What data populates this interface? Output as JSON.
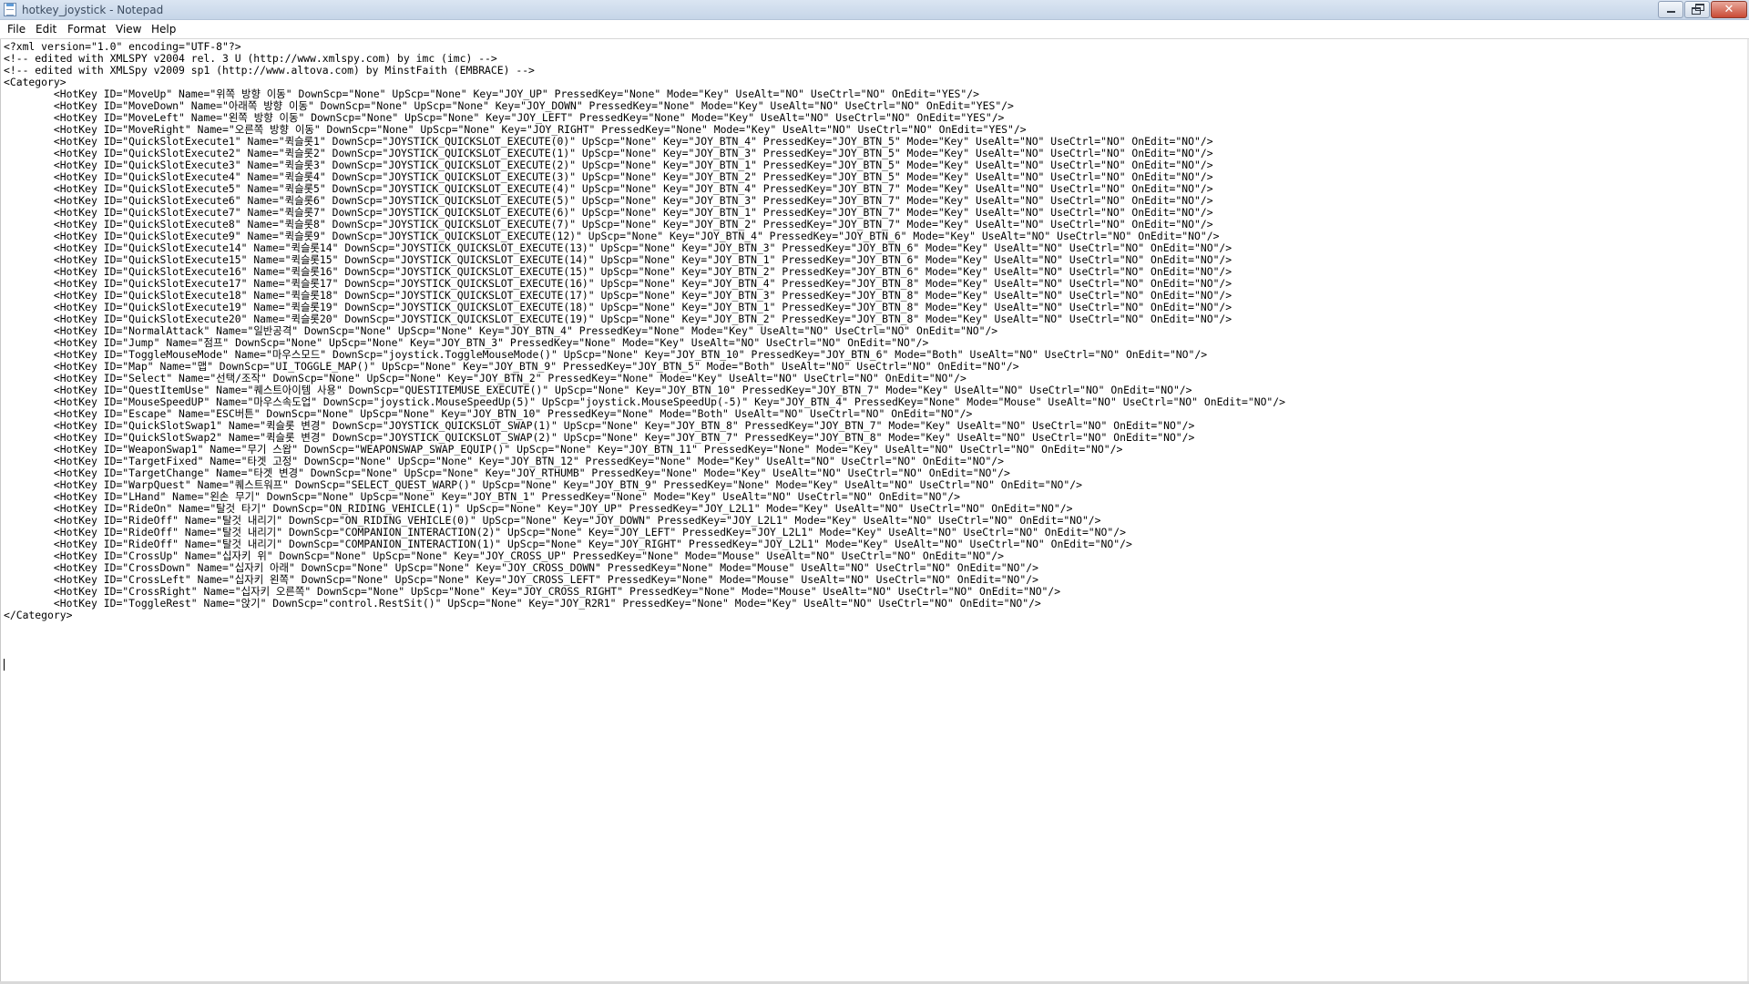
{
  "window": {
    "title": "hotkey_joystick - Notepad"
  },
  "menu": {
    "file": "File",
    "edit": "Edit",
    "format": "Format",
    "view": "View",
    "help": "Help"
  },
  "editor": {
    "content": "<?xml version=\"1.0\" encoding=\"UTF-8\"?>\n<!-- edited with XMLSPY v2004 rel. 3 U (http://www.xmlspy.com) by imc (imc) -->\n<!-- edited with XMLSpy v2009 sp1 (http://www.altova.com) by MinstFaith (EMBRACE) -->\n<Category>\n\t<HotKey ID=\"MoveUp\" Name=\"위쪽 방향 이동\" DownScp=\"None\" UpScp=\"None\" Key=\"JOY_UP\" PressedKey=\"None\" Mode=\"Key\" UseAlt=\"NO\" UseCtrl=\"NO\" OnEdit=\"YES\"/>\n\t<HotKey ID=\"MoveDown\" Name=\"아래쪽 방향 이동\" DownScp=\"None\" UpScp=\"None\" Key=\"JOY_DOWN\" PressedKey=\"None\" Mode=\"Key\" UseAlt=\"NO\" UseCtrl=\"NO\" OnEdit=\"YES\"/>\n\t<HotKey ID=\"MoveLeft\" Name=\"왼쪽 방향 이동\" DownScp=\"None\" UpScp=\"None\" Key=\"JOY_LEFT\" PressedKey=\"None\" Mode=\"Key\" UseAlt=\"NO\" UseCtrl=\"NO\" OnEdit=\"YES\"/>\n\t<HotKey ID=\"MoveRight\" Name=\"오른쪽 방향 이동\" DownScp=\"None\" UpScp=\"None\" Key=\"JOY_RIGHT\" PressedKey=\"None\" Mode=\"Key\" UseAlt=\"NO\" UseCtrl=\"NO\" OnEdit=\"YES\"/>\n\t<HotKey ID=\"QuickSlotExecute1\" Name=\"퀵슬롯1\" DownScp=\"JOYSTICK_QUICKSLOT_EXECUTE(0)\" UpScp=\"None\" Key=\"JOY_BTN_4\" PressedKey=\"JOY_BTN_5\" Mode=\"Key\" UseAlt=\"NO\" UseCtrl=\"NO\" OnEdit=\"NO\"/>\n\t<HotKey ID=\"QuickSlotExecute2\" Name=\"퀵슬롯2\" DownScp=\"JOYSTICK_QUICKSLOT_EXECUTE(1)\" UpScp=\"None\" Key=\"JOY_BTN_3\" PressedKey=\"JOY_BTN_5\" Mode=\"Key\" UseAlt=\"NO\" UseCtrl=\"NO\" OnEdit=\"NO\"/>\n\t<HotKey ID=\"QuickSlotExecute3\" Name=\"퀵슬롯3\" DownScp=\"JOYSTICK_QUICKSLOT_EXECUTE(2)\" UpScp=\"None\" Key=\"JOY_BTN_1\" PressedKey=\"JOY_BTN_5\" Mode=\"Key\" UseAlt=\"NO\" UseCtrl=\"NO\" OnEdit=\"NO\"/>\n\t<HotKey ID=\"QuickSlotExecute4\" Name=\"퀵슬롯4\" DownScp=\"JOYSTICK_QUICKSLOT_EXECUTE(3)\" UpScp=\"None\" Key=\"JOY_BTN_2\" PressedKey=\"JOY_BTN_5\" Mode=\"Key\" UseAlt=\"NO\" UseCtrl=\"NO\" OnEdit=\"NO\"/>\n\t<HotKey ID=\"QuickSlotExecute5\" Name=\"퀵슬롯5\" DownScp=\"JOYSTICK_QUICKSLOT_EXECUTE(4)\" UpScp=\"None\" Key=\"JOY_BTN_4\" PressedKey=\"JOY_BTN_7\" Mode=\"Key\" UseAlt=\"NO\" UseCtrl=\"NO\" OnEdit=\"NO\"/>\n\t<HotKey ID=\"QuickSlotExecute6\" Name=\"퀵슬롯6\" DownScp=\"JOYSTICK_QUICKSLOT_EXECUTE(5)\" UpScp=\"None\" Key=\"JOY_BTN_3\" PressedKey=\"JOY_BTN_7\" Mode=\"Key\" UseAlt=\"NO\" UseCtrl=\"NO\" OnEdit=\"NO\"/>\n\t<HotKey ID=\"QuickSlotExecute7\" Name=\"퀵슬롯7\" DownScp=\"JOYSTICK_QUICKSLOT_EXECUTE(6)\" UpScp=\"None\" Key=\"JOY_BTN_1\" PressedKey=\"JOY_BTN_7\" Mode=\"Key\" UseAlt=\"NO\" UseCtrl=\"NO\" OnEdit=\"NO\"/>\n\t<HotKey ID=\"QuickSlotExecute8\" Name=\"퀵슬롯8\" DownScp=\"JOYSTICK_QUICKSLOT_EXECUTE(7)\" UpScp=\"None\" Key=\"JOY_BTN_2\" PressedKey=\"JOY_BTN_7\" Mode=\"Key\" UseAlt=\"NO\" UseCtrl=\"NO\" OnEdit=\"NO\"/>\n\t<HotKey ID=\"QuickSlotExecute9\" Name=\"퀵슬롯9\" DownScp=\"JOYSTICK_QUICKSLOT_EXECUTE(12)\" UpScp=\"None\" Key=\"JOY_BTN_4\" PressedKey=\"JOY_BTN_6\" Mode=\"Key\" UseAlt=\"NO\" UseCtrl=\"NO\" OnEdit=\"NO\"/>\n\t<HotKey ID=\"QuickSlotExecute14\" Name=\"퀵슬롯14\" DownScp=\"JOYSTICK_QUICKSLOT_EXECUTE(13)\" UpScp=\"None\" Key=\"JOY_BTN_3\" PressedKey=\"JOY_BTN_6\" Mode=\"Key\" UseAlt=\"NO\" UseCtrl=\"NO\" OnEdit=\"NO\"/>\n\t<HotKey ID=\"QuickSlotExecute15\" Name=\"퀵슬롯15\" DownScp=\"JOYSTICK_QUICKSLOT_EXECUTE(14)\" UpScp=\"None\" Key=\"JOY_BTN_1\" PressedKey=\"JOY_BTN_6\" Mode=\"Key\" UseAlt=\"NO\" UseCtrl=\"NO\" OnEdit=\"NO\"/>\n\t<HotKey ID=\"QuickSlotExecute16\" Name=\"퀵슬롯16\" DownScp=\"JOYSTICK_QUICKSLOT_EXECUTE(15)\" UpScp=\"None\" Key=\"JOY_BTN_2\" PressedKey=\"JOY_BTN_6\" Mode=\"Key\" UseAlt=\"NO\" UseCtrl=\"NO\" OnEdit=\"NO\"/>\n\t<HotKey ID=\"QuickSlotExecute17\" Name=\"퀵슬롯17\" DownScp=\"JOYSTICK_QUICKSLOT_EXECUTE(16)\" UpScp=\"None\" Key=\"JOY_BTN_4\" PressedKey=\"JOY_BTN_8\" Mode=\"Key\" UseAlt=\"NO\" UseCtrl=\"NO\" OnEdit=\"NO\"/>\n\t<HotKey ID=\"QuickSlotExecute18\" Name=\"퀵슬롯18\" DownScp=\"JOYSTICK_QUICKSLOT_EXECUTE(17)\" UpScp=\"None\" Key=\"JOY_BTN_3\" PressedKey=\"JOY_BTN_8\" Mode=\"Key\" UseAlt=\"NO\" UseCtrl=\"NO\" OnEdit=\"NO\"/>\n\t<HotKey ID=\"QuickSlotExecute19\" Name=\"퀵슬롯19\" DownScp=\"JOYSTICK_QUICKSLOT_EXECUTE(18)\" UpScp=\"None\" Key=\"JOY_BTN_1\" PressedKey=\"JOY_BTN_8\" Mode=\"Key\" UseAlt=\"NO\" UseCtrl=\"NO\" OnEdit=\"NO\"/>\n\t<HotKey ID=\"QuickSlotExecute20\" Name=\"퀵슬롯20\" DownScp=\"JOYSTICK_QUICKSLOT_EXECUTE(19)\" UpScp=\"None\" Key=\"JOY_BTN_2\" PressedKey=\"JOY_BTN_8\" Mode=\"Key\" UseAlt=\"NO\" UseCtrl=\"NO\" OnEdit=\"NO\"/>\n\t<HotKey ID=\"NormalAttack\" Name=\"일반공격\" DownScp=\"None\" UpScp=\"None\" Key=\"JOY_BTN_4\" PressedKey=\"None\" Mode=\"Key\" UseAlt=\"NO\" UseCtrl=\"NO\" OnEdit=\"NO\"/>\n\t<HotKey ID=\"Jump\" Name=\"점프\" DownScp=\"None\" UpScp=\"None\" Key=\"JOY_BTN_3\" PressedKey=\"None\" Mode=\"Key\" UseAlt=\"NO\" UseCtrl=\"NO\" OnEdit=\"NO\"/>\n\t<HotKey ID=\"ToggleMouseMode\" Name=\"마우스모드\" DownScp=\"joystick.ToggleMouseMode()\" UpScp=\"None\" Key=\"JOY_BTN_10\" PressedKey=\"JOY_BTN_6\" Mode=\"Both\" UseAlt=\"NO\" UseCtrl=\"NO\" OnEdit=\"NO\"/>\n\t<HotKey ID=\"Map\" Name=\"맵\" DownScp=\"UI_TOGGLE_MAP()\" UpScp=\"None\" Key=\"JOY_BTN_9\" PressedKey=\"JOY_BTN_5\" Mode=\"Both\" UseAlt=\"NO\" UseCtrl=\"NO\" OnEdit=\"NO\"/>\n\t<HotKey ID=\"Select\" Name=\"선택/조작\" DownScp=\"None\" UpScp=\"None\" Key=\"JOY_BTN_2\" PressedKey=\"None\" Mode=\"Key\" UseAlt=\"NO\" UseCtrl=\"NO\" OnEdit=\"NO\"/>\n\t<HotKey ID=\"QuestItemUse\" Name=\"퀘스트아이템 사용\" DownScp=\"QUESTITEMUSE_EXECUTE()\" UpScp=\"None\" Key=\"JOY_BTN_10\" PressedKey=\"JOY_BTN_7\" Mode=\"Key\" UseAlt=\"NO\" UseCtrl=\"NO\" OnEdit=\"NO\"/>\n\t<HotKey ID=\"MouseSpeedUP\" Name=\"마우스속도업\" DownScp=\"joystick.MouseSpeedUp(5)\" UpScp=\"joystick.MouseSpeedUp(-5)\" Key=\"JOY_BTN_4\" PressedKey=\"None\" Mode=\"Mouse\" UseAlt=\"NO\" UseCtrl=\"NO\" OnEdit=\"NO\"/>\n\t<HotKey ID=\"Escape\" Name=\"ESC버튼\" DownScp=\"None\" UpScp=\"None\" Key=\"JOY_BTN_10\" PressedKey=\"None\" Mode=\"Both\" UseAlt=\"NO\" UseCtrl=\"NO\" OnEdit=\"NO\"/>\n\t<HotKey ID=\"QuickSlotSwap1\" Name=\"퀵슬롯 변경\" DownScp=\"JOYSTICK_QUICKSLOT_SWAP(1)\" UpScp=\"None\" Key=\"JOY_BTN_8\" PressedKey=\"JOY_BTN_7\" Mode=\"Key\" UseAlt=\"NO\" UseCtrl=\"NO\" OnEdit=\"NO\"/>\n\t<HotKey ID=\"QuickSlotSwap2\" Name=\"퀵슬롯 변경\" DownScp=\"JOYSTICK_QUICKSLOT_SWAP(2)\" UpScp=\"None\" Key=\"JOY_BTN_7\" PressedKey=\"JOY_BTN_8\" Mode=\"Key\" UseAlt=\"NO\" UseCtrl=\"NO\" OnEdit=\"NO\"/>\n\t<HotKey ID=\"WeaponSwap1\" Name=\"무기 스왑\" DownScp=\"WEAPONSWAP_SWAP_EQUIP()\" UpScp=\"None\" Key=\"JOY_BTN_11\" PressedKey=\"None\" Mode=\"Key\" UseAlt=\"NO\" UseCtrl=\"NO\" OnEdit=\"NO\"/>\n\t<HotKey ID=\"TargetFixed\" Name=\"타겟 고정\" DownScp=\"None\" UpScp=\"None\" Key=\"JOY_BTN_12\" PressedKey=\"None\" Mode=\"Key\" UseAlt=\"NO\" UseCtrl=\"NO\" OnEdit=\"NO\"/>\n\t<HotKey ID=\"TargetChange\" Name=\"타겟 변경\" DownScp=\"None\" UpScp=\"None\" Key=\"JOY_RTHUMB\" PressedKey=\"None\" Mode=\"Key\" UseAlt=\"NO\" UseCtrl=\"NO\" OnEdit=\"NO\"/>\n\t<HotKey ID=\"WarpQuest\" Name=\"퀘스트워프\" DownScp=\"SELECT_QUEST_WARP()\" UpScp=\"None\" Key=\"JOY_BTN_9\" PressedKey=\"None\" Mode=\"Key\" UseAlt=\"NO\" UseCtrl=\"NO\" OnEdit=\"NO\"/>\n\t<HotKey ID=\"LHand\" Name=\"왼손 무기\" DownScp=\"None\" UpScp=\"None\" Key=\"JOY_BTN_1\" PressedKey=\"None\" Mode=\"Key\" UseAlt=\"NO\" UseCtrl=\"NO\" OnEdit=\"NO\"/>\n\t<HotKey ID=\"RideOn\" Name=\"탈것 타기\" DownScp=\"ON_RIDING_VEHICLE(1)\" UpScp=\"None\" Key=\"JOY_UP\" PressedKey=\"JOY_L2L1\" Mode=\"Key\" UseAlt=\"NO\" UseCtrl=\"NO\" OnEdit=\"NO\"/>\n\t<HotKey ID=\"RideOff\" Name=\"탈것 내리기\" DownScp=\"ON_RIDING_VEHICLE(0)\" UpScp=\"None\" Key=\"JOY_DOWN\" PressedKey=\"JOY_L2L1\" Mode=\"Key\" UseAlt=\"NO\" UseCtrl=\"NO\" OnEdit=\"NO\"/>\n\t<HotKey ID=\"RideOff\" Name=\"탈것 내리기\" DownScp=\"COMPANION_INTERACTION(2)\" UpScp=\"None\" Key=\"JOY_LEFT\" PressedKey=\"JOY_L2L1\" Mode=\"Key\" UseAlt=\"NO\" UseCtrl=\"NO\" OnEdit=\"NO\"/>\n\t<HotKey ID=\"RideOff\" Name=\"탈것 내리기\" DownScp=\"COMPANION_INTERACTION(1)\" UpScp=\"None\" Key=\"JOY_RIGHT\" PressedKey=\"JOY_L2L1\" Mode=\"Key\" UseAlt=\"NO\" UseCtrl=\"NO\" OnEdit=\"NO\"/>\n\t<HotKey ID=\"CrossUp\" Name=\"십자키 위\" DownScp=\"None\" UpScp=\"None\" Key=\"JOY_CROSS_UP\" PressedKey=\"None\" Mode=\"Mouse\" UseAlt=\"NO\" UseCtrl=\"NO\" OnEdit=\"NO\"/>\n\t<HotKey ID=\"CrossDown\" Name=\"십자키 아래\" DownScp=\"None\" UpScp=\"None\" Key=\"JOY_CROSS_DOWN\" PressedKey=\"None\" Mode=\"Mouse\" UseAlt=\"NO\" UseCtrl=\"NO\" OnEdit=\"NO\"/>\n\t<HotKey ID=\"CrossLeft\" Name=\"십자키 왼쪽\" DownScp=\"None\" UpScp=\"None\" Key=\"JOY_CROSS_LEFT\" PressedKey=\"None\" Mode=\"Mouse\" UseAlt=\"NO\" UseCtrl=\"NO\" OnEdit=\"NO\"/>\n\t<HotKey ID=\"CrossRight\" Name=\"십자키 오른쪽\" DownScp=\"None\" UpScp=\"None\" Key=\"JOY_CROSS_RIGHT\" PressedKey=\"None\" Mode=\"Mouse\" UseAlt=\"NO\" UseCtrl=\"NO\" OnEdit=\"NO\"/>\n\t<HotKey ID=\"ToggleRest\" Name=\"앉기\" DownScp=\"control.RestSit()\" UpScp=\"None\" Key=\"JOY_R2R1\" PressedKey=\"None\" Mode=\"Key\" UseAlt=\"NO\" UseCtrl=\"NO\" OnEdit=\"NO\"/>\n</Category>"
  }
}
